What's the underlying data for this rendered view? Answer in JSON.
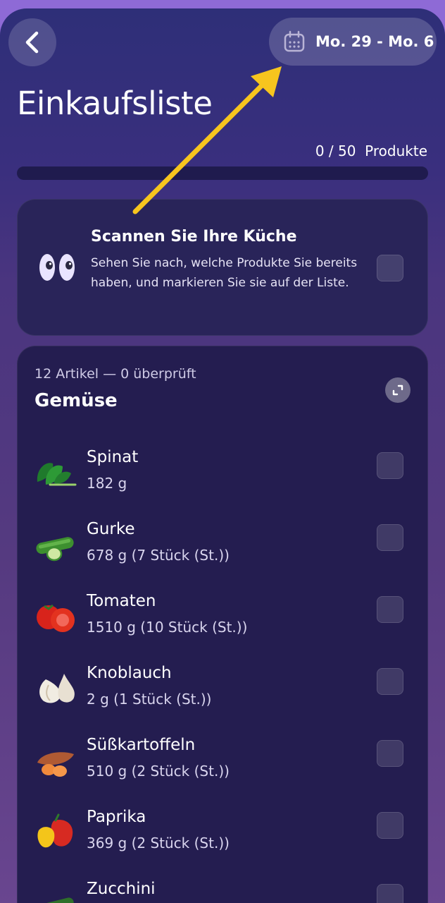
{
  "header": {
    "date_range": "Mo. 29 - Mo. 6"
  },
  "page": {
    "title": "Einkaufsliste",
    "count": "0 / 50",
    "count_unit": "Produkte",
    "progress_fraction": 0
  },
  "scan": {
    "title": "Scannen Sie Ihre Küche",
    "description": "Sehen Sie nach, welche Produkte Sie bereits haben, und markieren Sie sie auf der Liste."
  },
  "category": {
    "meta": "12 Artikel — 0 überprüft",
    "name": "Gemüse",
    "items": [
      {
        "name": "Spinat",
        "qty": "182 g",
        "icon": "spinach-icon"
      },
      {
        "name": "Gurke",
        "qty": "678 g  (7 Stück (St.))",
        "icon": "cucumber-icon"
      },
      {
        "name": "Tomaten",
        "qty": "1510 g  (10 Stück (St.))",
        "icon": "tomato-icon"
      },
      {
        "name": "Knoblauch",
        "qty": "2 g  (1 Stück (St.))",
        "icon": "garlic-icon"
      },
      {
        "name": "Süßkartoffeln",
        "qty": "510 g  (2 Stück (St.))",
        "icon": "sweet-potato-icon"
      },
      {
        "name": "Paprika",
        "qty": "369 g  (2 Stück (St.))",
        "icon": "bell-pepper-icon"
      },
      {
        "name": "Zucchini",
        "qty": "",
        "icon": "zucchini-icon"
      }
    ]
  },
  "colors": {
    "accent_arrow": "#f7c51e",
    "card_bg": "#241d50"
  }
}
